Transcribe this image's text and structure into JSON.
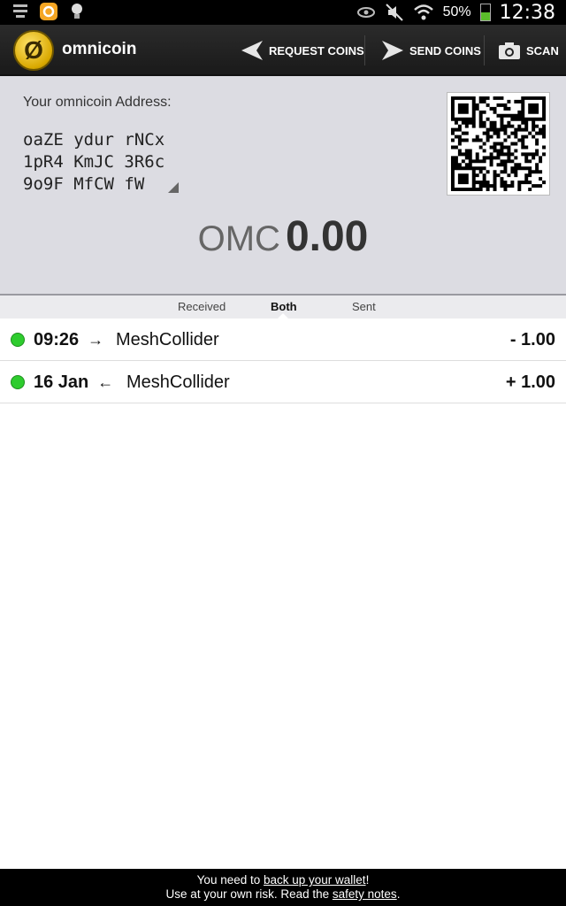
{
  "status_bar": {
    "battery_pct": "50%",
    "time": "12:38",
    "icons_left": [
      "notification-icon",
      "sync-icon",
      "bulb-icon"
    ],
    "icons_right": [
      "eye-icon",
      "mute-icon",
      "wifi-icon",
      "battery-icon"
    ]
  },
  "action_bar": {
    "logo_glyph": "Ø",
    "title": "omnicoin",
    "request_label": "REQUEST COINS",
    "send_label": "SEND COINS",
    "scan_label": "SCAN"
  },
  "address": {
    "label": "Your omnicoin Address:",
    "line1": "oaZE ydur rNCx",
    "line2": "1pR4 KmJC 3R6c",
    "line3": "9o9F MfCW fW"
  },
  "balance": {
    "currency": "OMC",
    "amount": "0.00"
  },
  "tabs": [
    {
      "label": "Received"
    },
    {
      "label": "Both"
    },
    {
      "label": "Sent"
    }
  ],
  "transactions": [
    {
      "time": "09:26",
      "arrow": "→",
      "party": "MeshCollider",
      "amount": "- 1.00"
    },
    {
      "time": "16 Jan",
      "arrow": "←",
      "party": "MeshCollider",
      "amount": "+ 1.00"
    }
  ],
  "footer": {
    "line1_pre": "You need to ",
    "line1_link": "back up your wallet",
    "line1_post": "!",
    "line2_pre": "Use at your own risk. Read the ",
    "line2_link": "safety notes",
    "line2_post": "."
  },
  "colors": {
    "action_bar_bg": "#222222",
    "address_panel_bg": "#dcdce2",
    "status_dot": "#2ecc2e"
  }
}
